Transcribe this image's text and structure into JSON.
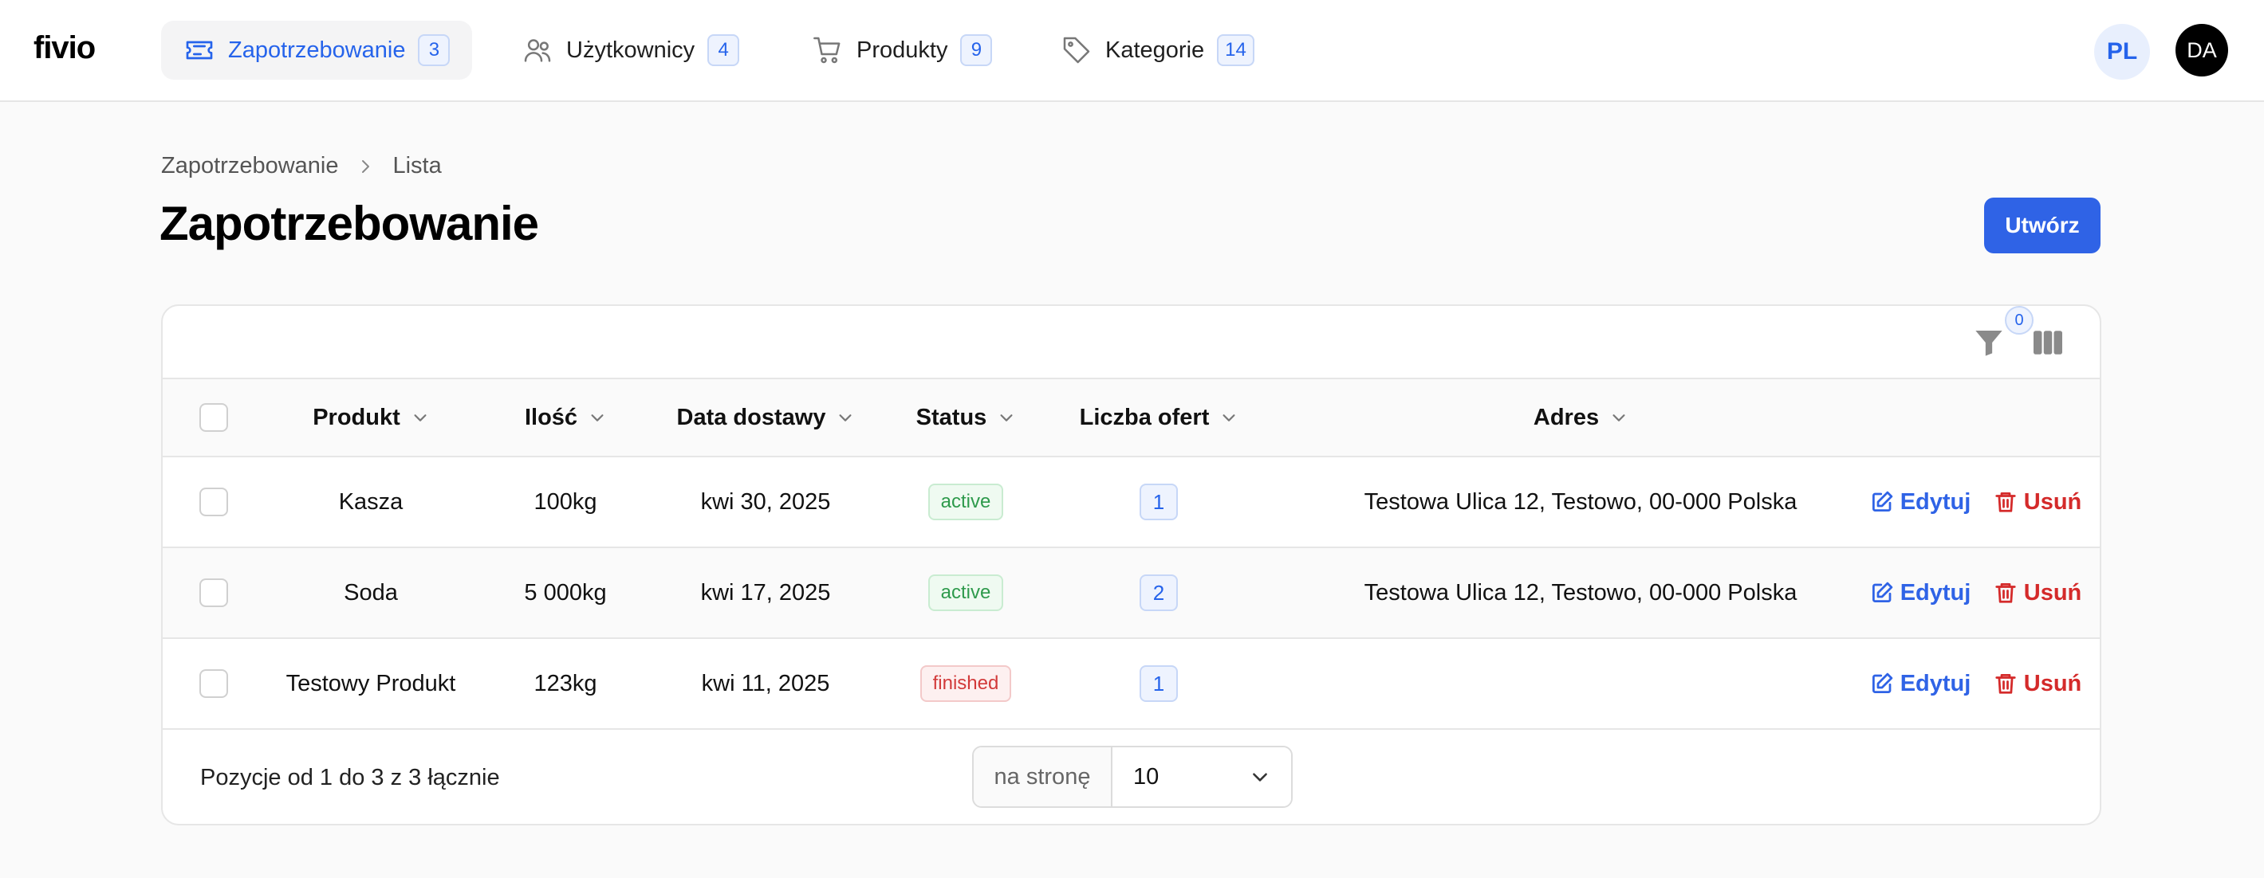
{
  "app": {
    "logo": "fivio"
  },
  "nav": {
    "items": [
      {
        "label": "Zapotrzebowanie",
        "count": "3",
        "icon": "ticket-icon",
        "active": true
      },
      {
        "label": "Użytkownicy",
        "count": "4",
        "icon": "users-icon",
        "active": false
      },
      {
        "label": "Produkty",
        "count": "9",
        "icon": "cart-icon",
        "active": false
      },
      {
        "label": "Kategorie",
        "count": "14",
        "icon": "tag-icon",
        "active": false
      }
    ],
    "language": "PL",
    "avatar": "DA"
  },
  "breadcrumb": {
    "items": [
      "Zapotrzebowanie",
      "Lista"
    ]
  },
  "page": {
    "title": "Zapotrzebowanie",
    "create_label": "Utwórz"
  },
  "toolbar": {
    "filter_count": "0"
  },
  "table": {
    "columns": [
      "Produkt",
      "Ilość",
      "Data dostawy",
      "Status",
      "Liczba ofert",
      "Adres"
    ],
    "rows": [
      {
        "product": "Kasza",
        "quantity": "100kg",
        "delivery": "kwi 30, 2025",
        "status": "active",
        "offers": "1",
        "address": "Testowa Ulica 12, Testowo, 00-000 Polska"
      },
      {
        "product": "Soda",
        "quantity": "5 000kg",
        "delivery": "kwi 17, 2025",
        "status": "active",
        "offers": "2",
        "address": "Testowa Ulica 12, Testowo, 00-000 Polska"
      },
      {
        "product": "Testowy Produkt",
        "quantity": "123kg",
        "delivery": "kwi 11, 2025",
        "status": "finished",
        "offers": "1",
        "address": ""
      }
    ],
    "actions": {
      "edit": "Edytuj",
      "delete": "Usuń"
    }
  },
  "pagination": {
    "summary": "Pozycje od 1 do 3 z 3 łącznie",
    "per_page_label": "na stronę",
    "per_page_value": "10"
  },
  "colors": {
    "accent": "#2f63e6",
    "danger": "#d42a2a",
    "success": "#2e9a4c"
  }
}
